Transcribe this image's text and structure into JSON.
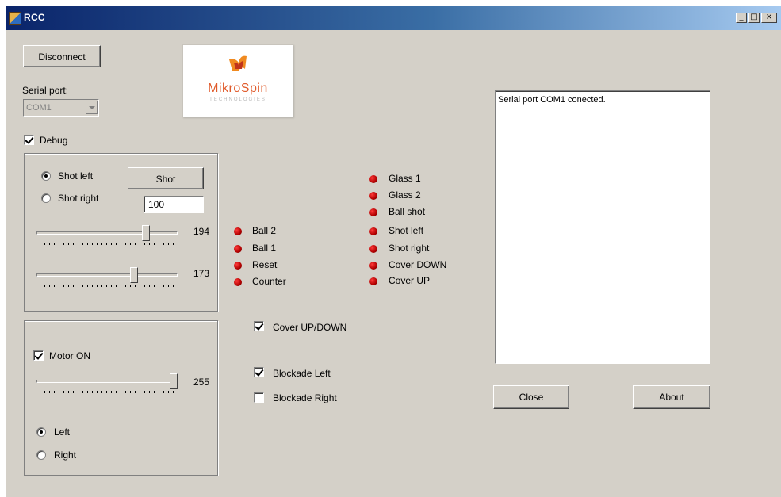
{
  "window": {
    "title": "RCC",
    "controls": {
      "minimize": "_",
      "maximize": "□",
      "close": "×"
    }
  },
  "connection": {
    "disconnect_label": "Disconnect",
    "serial_port_label": "Serial port:",
    "serial_port_value": "COM1"
  },
  "logo": {
    "name": "MikroSpin",
    "subtitle": "TECHNOLOGIES"
  },
  "debug": {
    "label": "Debug",
    "checked": true
  },
  "shot_panel": {
    "shot_left_label": "Shot left",
    "shot_right_label": "Shot right",
    "selected": "Shot left",
    "shot_button": "Shot",
    "shot_value": "100",
    "slider1_value": "194",
    "slider2_value": "173"
  },
  "motor_panel": {
    "motor_on_label": "Motor ON",
    "motor_on_checked": true,
    "slider_value": "255",
    "left_label": "Left",
    "right_label": "Right",
    "selected": "Left"
  },
  "indicators_left": [
    "Ball 2",
    "Ball 1",
    "Reset",
    "Counter"
  ],
  "indicators_right": [
    "Glass 1",
    "Glass 2",
    "Ball shot",
    "Shot left",
    "Shot right",
    "Cover DOWN",
    "Cover UP"
  ],
  "options": {
    "cover": {
      "label": "Cover UP/DOWN",
      "checked": true
    },
    "blockade_left": {
      "label": "Blockade Left",
      "checked": true
    },
    "blockade_right": {
      "label": "Blockade Right",
      "checked": false
    }
  },
  "log": {
    "text": "Serial port COM1 conected."
  },
  "footer": {
    "close_label": "Close",
    "about_label": "About"
  },
  "colors": {
    "titlebar_start": "#0a246a",
    "titlebar_end": "#a6caf0",
    "led": "#c00000",
    "face": "#d4d0c8"
  }
}
